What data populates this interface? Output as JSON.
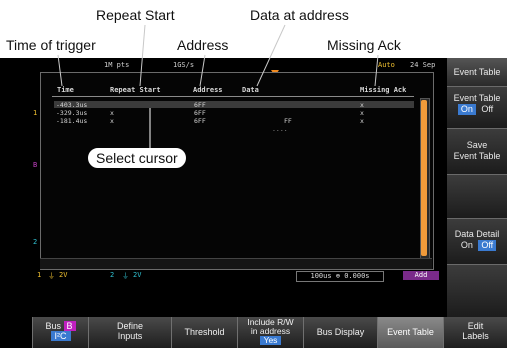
{
  "callouts": {
    "repeat_start": "Repeat Start",
    "data_at_address": "Data at address",
    "time_of_trigger": "Time of trigger",
    "address": "Address",
    "missing_ack": "Missing Ack",
    "select_cursor": "Select cursor"
  },
  "topbar": {
    "points": "1M pts",
    "sample_rate": "1GS/s",
    "mode": "Auto",
    "date": "24 Sep"
  },
  "table": {
    "columns": [
      "Time",
      "Repeat Start",
      "Address",
      "Data",
      "Missing Ack"
    ],
    "rows": [
      {
        "time": "-403.3us",
        "repeat": "",
        "address": "6FF",
        "data": "",
        "ack": "x"
      },
      {
        "time": "-329.3us",
        "repeat": "x",
        "address": "6FF",
        "data": "",
        "ack": "x"
      },
      {
        "time": "-181.4us",
        "repeat": "x",
        "address": "6FF",
        "data": "FF",
        "ack": "x"
      }
    ],
    "ellipsis": "...."
  },
  "status": {
    "ch1": "1",
    "ch1_scale": "2V",
    "ch2": "2",
    "ch2_scale": "2V",
    "timebase": "100us",
    "time_offset": "0.000s",
    "acq": "Add"
  },
  "side_menu": {
    "title": "Event Table",
    "event_table_label": "Event Table",
    "on": "On",
    "off": "Off",
    "save_line1": "Save",
    "save_line2": "Event Table",
    "detail_label": "Data Detail",
    "detail_on": "On",
    "detail_off": "Off"
  },
  "bottom_menu": {
    "bus_label": "Bus",
    "bus_id": "B",
    "bus_type": "I²C",
    "define_line1": "Define",
    "define_line2": "Inputs",
    "threshold": "Threshold",
    "include_line1": "Include R/W",
    "include_line2": "in address",
    "include_value": "Yes",
    "bus_display": "Bus Display",
    "event_table": "Event Table",
    "edit_line1": "Edit",
    "edit_line2": "Labels"
  },
  "colors": {
    "accent_blue": "#3a7ad0",
    "scroll_orange": "#f09a3a",
    "ch1_yellow": "#f0c030",
    "ch2_cyan": "#30c0d0",
    "bus_magenta": "#c020c0"
  }
}
